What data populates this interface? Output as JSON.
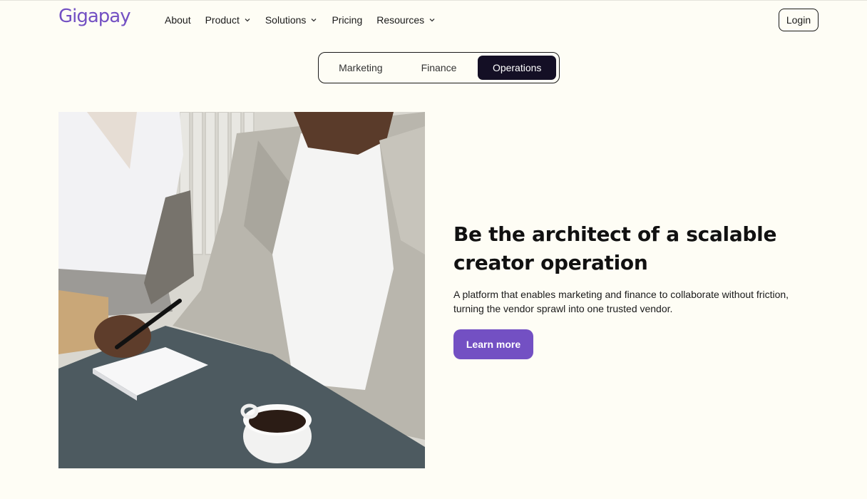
{
  "brand": {
    "logo_text": "Gigapay",
    "accent": "#7350c3"
  },
  "nav": {
    "items": [
      {
        "label": "About",
        "has_dropdown": false
      },
      {
        "label": "Product",
        "has_dropdown": true
      },
      {
        "label": "Solutions",
        "has_dropdown": true
      },
      {
        "label": "Pricing",
        "has_dropdown": false
      },
      {
        "label": "Resources",
        "has_dropdown": true
      }
    ],
    "login_label": "Login"
  },
  "tabs": {
    "items": [
      {
        "label": "Marketing",
        "active": false
      },
      {
        "label": "Finance",
        "active": false
      },
      {
        "label": "Operations",
        "active": true
      }
    ]
  },
  "hero": {
    "headline": "Be the architect of a scalable creator operation",
    "description": "A platform that enables marketing and finance to collaborate without friction, turning the vendor sprawl into one trusted vendor.",
    "cta_label": "Learn more"
  },
  "colors": {
    "background": "#fefdf5",
    "active_tab": "#140f25",
    "cta": "#7350c3"
  }
}
